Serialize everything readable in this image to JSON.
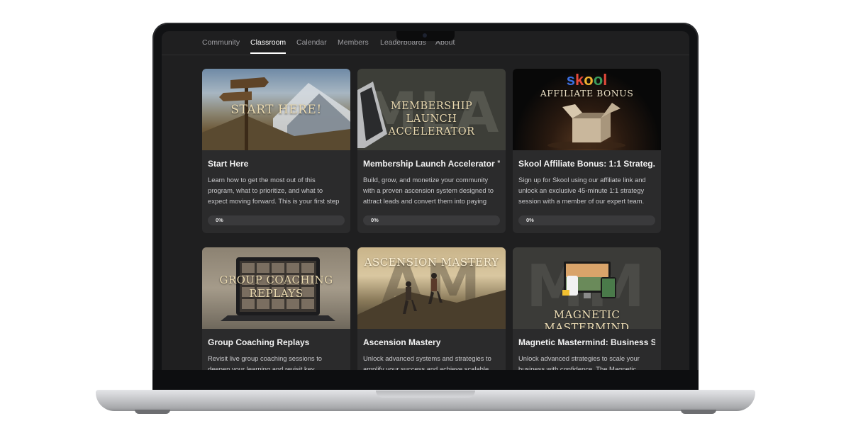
{
  "nav": {
    "tabs": [
      {
        "label": "Community"
      },
      {
        "label": "Classroom"
      },
      {
        "label": "Calendar"
      },
      {
        "label": "Members"
      },
      {
        "label": "Leaderboards"
      },
      {
        "label": "About"
      }
    ],
    "active_tab": "Classroom"
  },
  "courses": [
    {
      "thumb_text": "START HERE!",
      "title": "Start Here",
      "description": "Learn how to get the most out of this program, what to prioritize, and what to expect moving forward. This is your first step",
      "progress_label": "0%",
      "progress": 0
    },
    {
      "thumb_text": "MEMBERSHIP LAUNCH ACCELERATOR",
      "thumb_bg_letters": "MLA",
      "title": "Membership Launch Accelerator \"...",
      "description": "Build, grow, and monetize your community with a proven ascension system designed to attract leads and convert them into paying",
      "progress_label": "0%",
      "progress": 0
    },
    {
      "thumb_brand": "skool",
      "thumb_text": "AFFILIATE BONUS",
      "title": "Skool Affiliate Bonus: 1:1 Strateg...",
      "description": "Sign up for Skool using our affiliate link and unlock an exclusive 45-minute 1:1 strategy session with a member of our expert team.",
      "progress_label": "0%",
      "progress": 0
    },
    {
      "thumb_text": "GROUP COACHING REPLAYS",
      "title": "Group Coaching Replays",
      "description": "Revisit live group coaching sessions to deepen your learning and revisit key"
    },
    {
      "thumb_text": "ASCENSION MASTERY",
      "thumb_bg_letters": "AM",
      "title": "Ascension Mastery",
      "description": "Unlock advanced systems and strategies to amplify your success and achieve scalable"
    },
    {
      "thumb_text": "MAGNETIC MASTERMIND",
      "thumb_bg_letters": "MM",
      "title": "Magnetic Mastermind: Business S...",
      "description": "Unlock advanced strategies to scale your business with confidence. The Magnetic"
    }
  ],
  "colors": {
    "screen_bg": "#1f1f20",
    "card_bg": "#2b2b2c",
    "thumb_text": "#e9d9b0",
    "skool_s": "#3b6fe0",
    "skool_k": "#e64b3b",
    "skool_o1": "#f3b530",
    "skool_o2": "#3c9d5d",
    "skool_l": "#e64b3b"
  }
}
